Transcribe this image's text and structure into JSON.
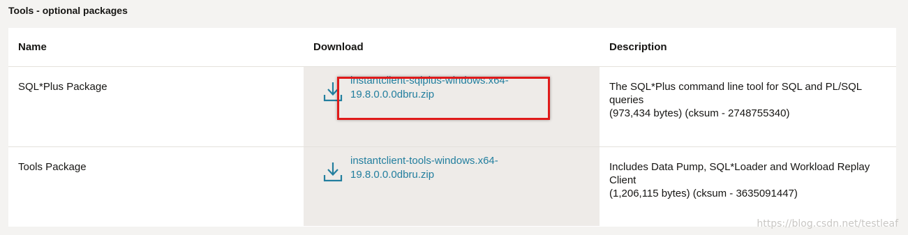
{
  "section": {
    "title": "Tools - optional packages"
  },
  "table": {
    "headers": [
      "Name",
      "Download",
      "Description"
    ],
    "rows": [
      {
        "name": "SQL*Plus Package",
        "download_line1": "instantclient-sqlplus-windows.x64-",
        "download_line2": "19.8.0.0.0dbru.zip",
        "desc_line1": "The SQL*Plus command line tool for SQL and PL/SQL",
        "desc_line2": "queries",
        "desc_line3": "(973,434 bytes) (cksum - 2748755340)"
      },
      {
        "name": "Tools Package",
        "download_line1": "instantclient-tools-windows.x64-",
        "download_line2": "19.8.0.0.0dbru.zip",
        "desc_line1": "Includes Data Pump, SQL*Loader and Workload Replay",
        "desc_line2": "Client",
        "desc_line3": "(1,206,115 bytes) (cksum - 3635091447)"
      }
    ]
  },
  "watermark": "https://blog.csdn.net/testleaf",
  "colors": {
    "link": "#227e9e",
    "highlight": "#e01a1a",
    "download_bg": "#eeebe8"
  }
}
